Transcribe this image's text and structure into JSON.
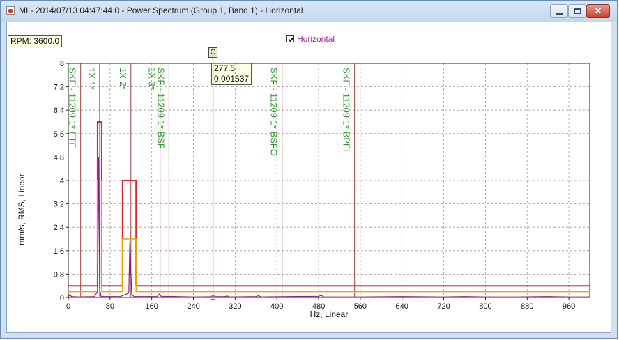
{
  "window": {
    "title": "MI - 2014/07/13 04:47:44.0 - Power Spectrum (Group 1, Band 1) - Horizontal",
    "icon": "app-document-icon",
    "buttons": {
      "minimize": "minimize-icon",
      "maximize": "maximize-icon",
      "close": "close-icon"
    },
    "close_glyph": "✕"
  },
  "rpm_label": "RPM: 3600.0",
  "legend": {
    "label": "Horizontal",
    "checked": true,
    "color": "#a22aa3"
  },
  "cursor": {
    "tag": "C",
    "x_value": "277.5",
    "y_value": "0.001537",
    "color": "#e8372f"
  },
  "colors": {
    "spectrum": "#8b1a8e",
    "red_alarm": "#e0262a",
    "orange_alarm": "#f0a500",
    "fault_line": "#a34444",
    "cursor_line": "#e8372f",
    "marker_text": "#2b9a2b",
    "grid": "#9a9a9a"
  },
  "chart_data": {
    "type": "line",
    "xlabel": "Hz, Linear",
    "ylabel": "mm/s, RMS, Linear",
    "xlim": [
      0,
      1000
    ],
    "ylim": [
      0,
      8
    ],
    "x_ticks": [
      "0",
      "80",
      "160",
      "240",
      "320",
      "400",
      "480",
      "560",
      "640",
      "720",
      "800",
      "880",
      "960"
    ],
    "y_ticks": [
      "0",
      "0.8",
      "1.6",
      "2.4",
      "3.2",
      "4",
      "4.8",
      "5.6",
      "6.4",
      "7.2",
      "8"
    ],
    "grid": true,
    "series": [
      {
        "name": "Horizontal",
        "points": [
          [
            0,
            0.02
          ],
          [
            3,
            0.1
          ],
          [
            6,
            0.03
          ],
          [
            20,
            0.02
          ],
          [
            50,
            0.03
          ],
          [
            56,
            0.2
          ],
          [
            58,
            4.8
          ],
          [
            60,
            0.3
          ],
          [
            63,
            0.03
          ],
          [
            100,
            0.03
          ],
          [
            116,
            0.15
          ],
          [
            118,
            1.9
          ],
          [
            120,
            0.8
          ],
          [
            122,
            0.1
          ],
          [
            126,
            0.03
          ],
          [
            170,
            0.03
          ],
          [
            175,
            0.12
          ],
          [
            178,
            0.04
          ],
          [
            240,
            0.02
          ],
          [
            300,
            0.03
          ],
          [
            305,
            0.05
          ],
          [
            310,
            0.02
          ],
          [
            360,
            0.03
          ],
          [
            365,
            0.06
          ],
          [
            370,
            0.02
          ],
          [
            420,
            0.03
          ],
          [
            480,
            0.04
          ],
          [
            485,
            0.07
          ],
          [
            490,
            0.02
          ],
          [
            560,
            0.02
          ],
          [
            640,
            0.03
          ],
          [
            720,
            0.02
          ],
          [
            760,
            0.03
          ],
          [
            800,
            0.02
          ],
          [
            860,
            0.02
          ],
          [
            920,
            0.03
          ],
          [
            960,
            0.02
          ],
          [
            1000,
            0.02
          ]
        ]
      }
    ],
    "alarm_bands": [
      {
        "level": "alert",
        "points": [
          [
            0,
            0.4
          ],
          [
            56,
            0.4
          ],
          [
            56,
            6.0
          ],
          [
            64,
            6.0
          ],
          [
            64,
            0.4
          ],
          [
            104,
            0.4
          ],
          [
            104,
            4.0
          ],
          [
            130,
            4.0
          ],
          [
            130,
            0.4
          ],
          [
            1000,
            0.4
          ]
        ]
      },
      {
        "level": "warning",
        "points": [
          [
            0,
            0.2
          ],
          [
            56,
            0.2
          ],
          [
            56,
            4.0
          ],
          [
            64,
            4.0
          ],
          [
            64,
            0.2
          ],
          [
            104,
            0.2
          ],
          [
            104,
            2.0
          ],
          [
            130,
            2.0
          ],
          [
            130,
            0.2
          ],
          [
            1000,
            0.2
          ]
        ]
      }
    ],
    "fault_markers": [
      {
        "x": 23.6,
        "label": "SKF - 11209 1* FTF"
      },
      {
        "x": 60,
        "label": "1X 1*"
      },
      {
        "x": 120,
        "label": "1X 2*"
      },
      {
        "x": 176,
        "label": "1X 3*"
      },
      {
        "x": 193,
        "label": "SKF - 11209 1* BSF"
      },
      {
        "x": 410,
        "label": "SKF - 11209 1* BSFO"
      },
      {
        "x": 549,
        "label": "SKF - 11209 1* BPFI"
      }
    ],
    "cursor_x": 277.5,
    "cursor_y": 0.001537
  }
}
